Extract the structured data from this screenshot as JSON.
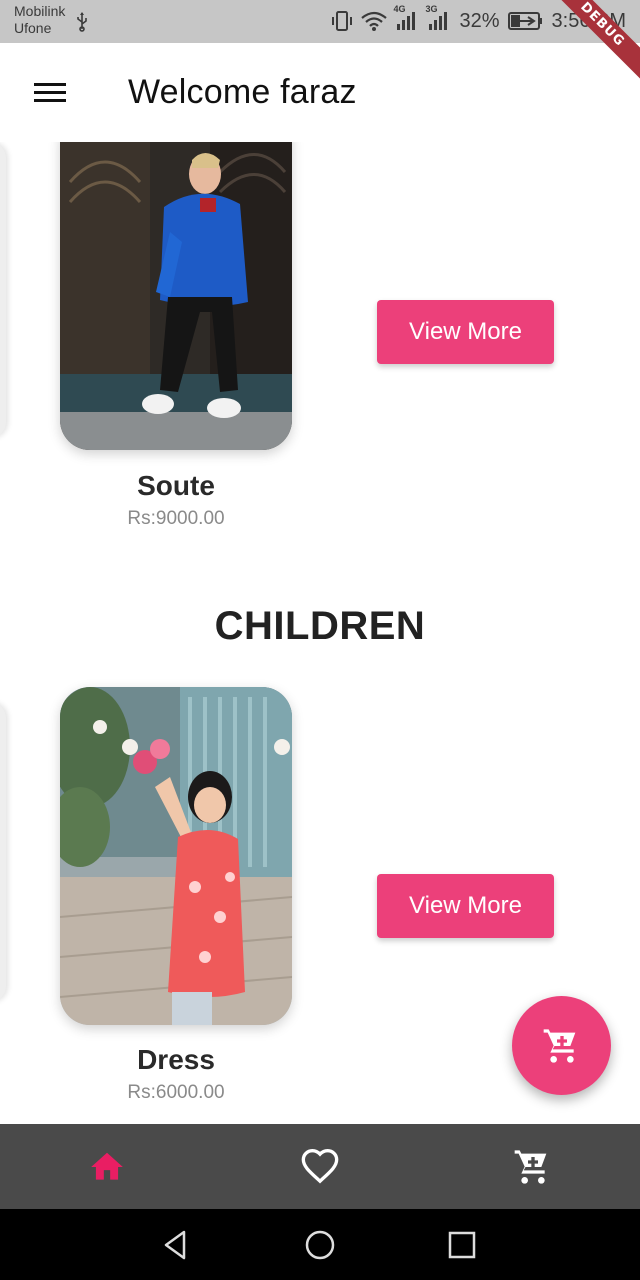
{
  "status_bar": {
    "carrier_1": "Mobilink",
    "carrier_2": "Ufone",
    "network_1": "4G",
    "network_2": "3G",
    "battery": "32%",
    "time": "3:56 PM",
    "debug_banner": "DEBUG",
    "icons": [
      "usb-icon",
      "vibrate-icon",
      "wifi-icon",
      "signal-icon",
      "battery-charging-icon"
    ]
  },
  "app_bar": {
    "title": "Welcome faraz",
    "menu_icon": "hamburger-menu-icon"
  },
  "sections": [
    {
      "title": "",
      "product": {
        "name": "Soute",
        "price": "Rs:9000.00",
        "button": "View More"
      }
    },
    {
      "title": "CHILDREN",
      "product": {
        "name": "Dress",
        "price": "Rs:6000.00",
        "button": "View More"
      }
    }
  ],
  "fab": {
    "icon": "cart-icon"
  },
  "bottom_nav": {
    "items": [
      {
        "icon": "home-icon",
        "active": true
      },
      {
        "icon": "heart-outline-icon",
        "active": false
      },
      {
        "icon": "cart-icon",
        "active": false
      }
    ],
    "active_color": "#e91e63",
    "inactive_color": "#ffffff"
  },
  "system_nav": {
    "icons": [
      "back-icon",
      "home-circle-icon",
      "recents-icon"
    ]
  },
  "colors": {
    "accent": "#ec407a",
    "status_bar": "#c6c6c6",
    "bottom_nav": "#4a4a4a"
  }
}
